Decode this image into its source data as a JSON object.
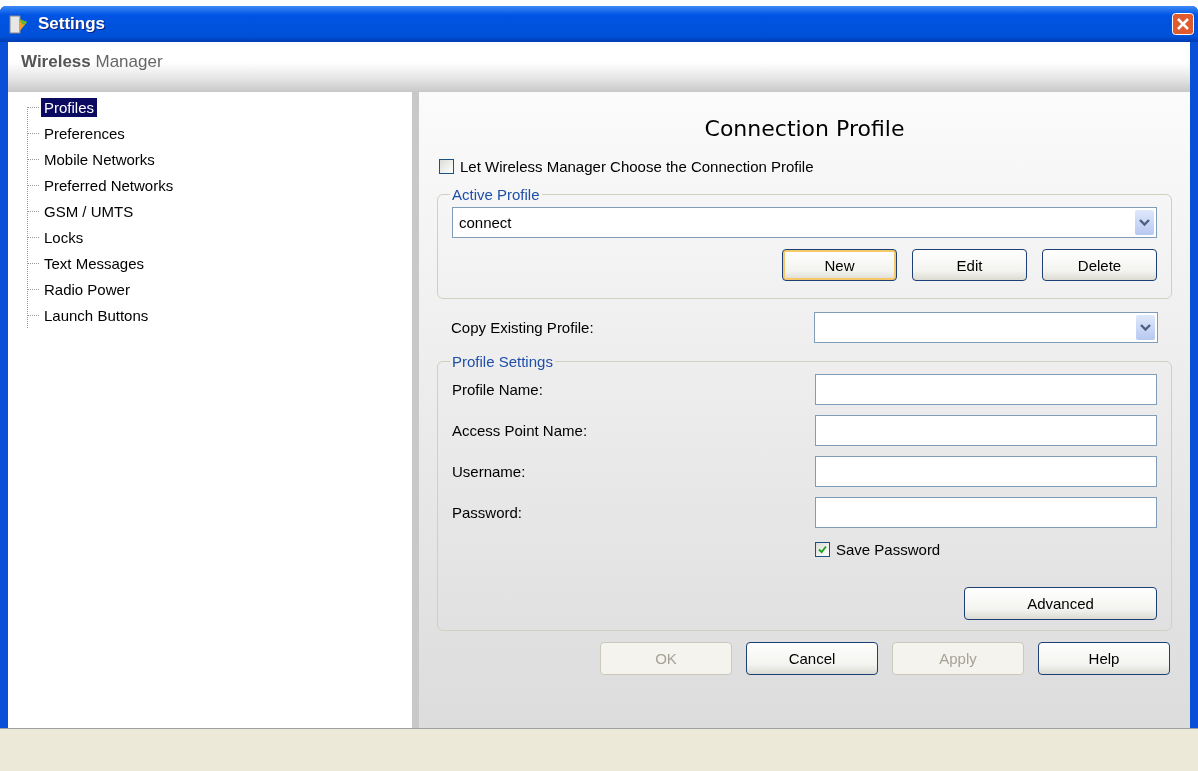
{
  "window": {
    "title": "Settings"
  },
  "header": {
    "title": "**Wireless** Manager"
  },
  "sidebar": {
    "items": [
      {
        "label": "Profiles",
        "selected": true
      },
      {
        "label": "Preferences",
        "selected": false
      },
      {
        "label": "Mobile Networks",
        "selected": false
      },
      {
        "label": "Preferred Networks",
        "selected": false
      },
      {
        "label": "GSM / UMTS",
        "selected": false
      },
      {
        "label": "Locks",
        "selected": false
      },
      {
        "label": "Text Messages",
        "selected": false
      },
      {
        "label": "Radio Power",
        "selected": false
      },
      {
        "label": "Launch Buttons",
        "selected": false
      }
    ]
  },
  "panel": {
    "title": "Connection Profile",
    "auto_choose": {
      "label": "Let Wireless Manager Choose the Connection Profile",
      "checked": false
    },
    "active_profile": {
      "legend": "Active Profile",
      "value": "connect",
      "buttons": [
        {
          "label": "New",
          "default": true
        },
        {
          "label": "Edit",
          "default": false
        },
        {
          "label": "Delete",
          "default": false
        }
      ]
    },
    "copy_existing": {
      "label": "Copy Existing Profile:"
    },
    "profile_settings": {
      "legend": "Profile Settings",
      "fields": [
        {
          "label": "Profile Name:"
        },
        {
          "label": "Access Point Name:"
        },
        {
          "label": "Username:"
        },
        {
          "label": "Password:"
        }
      ],
      "save_password": {
        "label": "Save Password",
        "checked": true
      },
      "advanced": {
        "label": "Advanced"
      }
    }
  },
  "buttons": [
    {
      "label": "OK",
      "disabled": true
    },
    {
      "label": "Cancel",
      "disabled": false
    },
    {
      "label": "Apply",
      "disabled": true
    },
    {
      "label": "Help",
      "disabled": false
    }
  ]
}
